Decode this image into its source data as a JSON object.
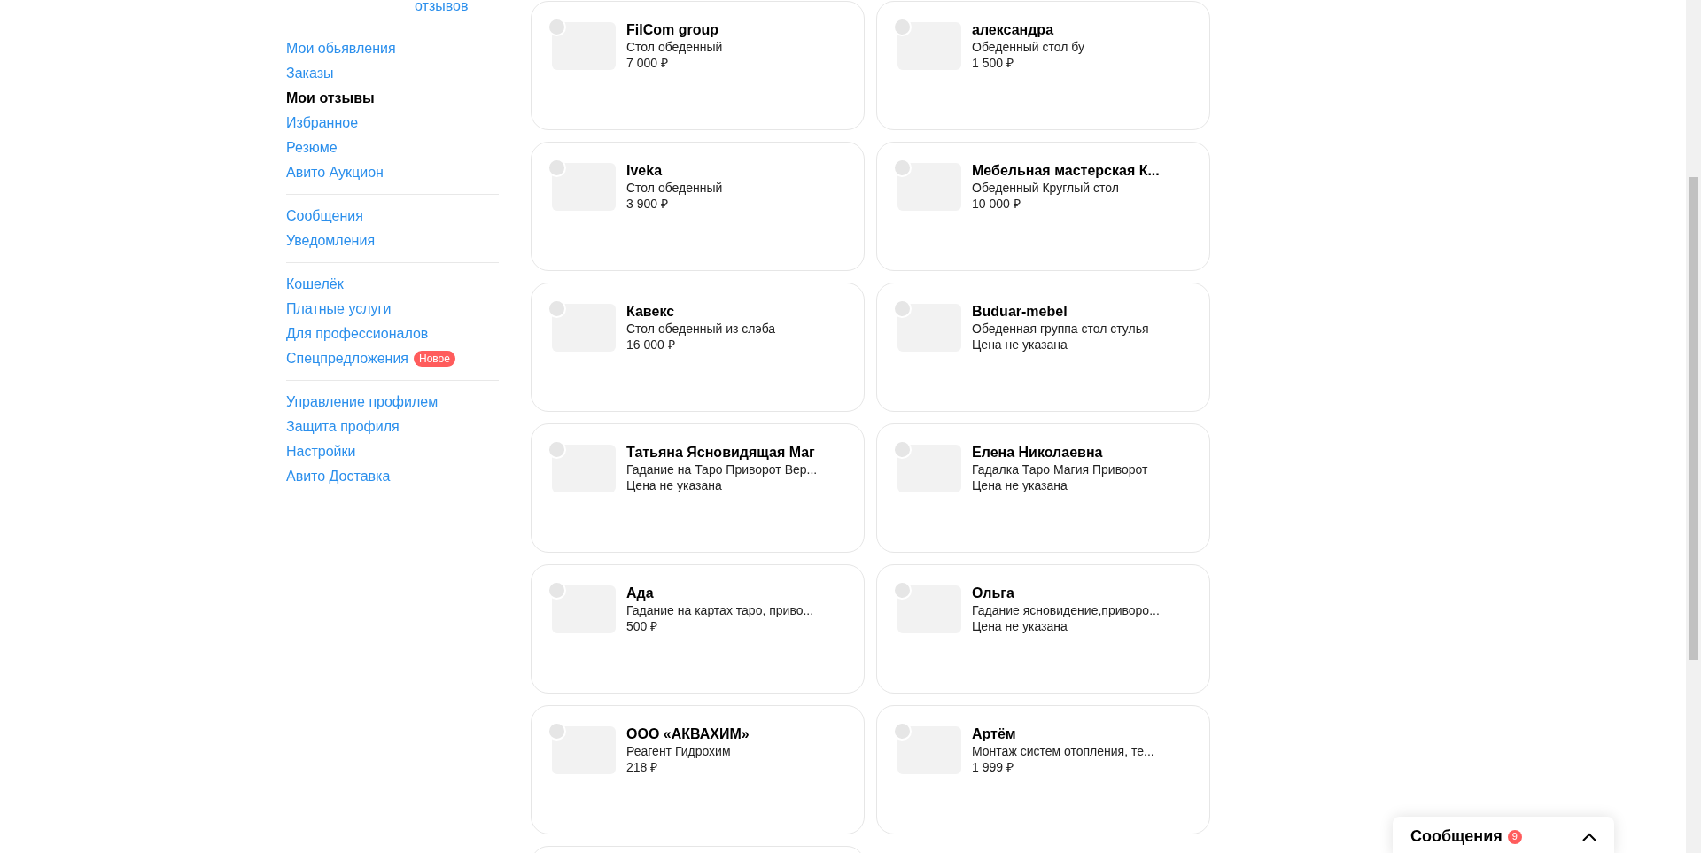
{
  "sidebar": {
    "top_link": "отзывов",
    "groups": [
      [
        {
          "label": "Мои обьявления",
          "selected": false
        },
        {
          "label": "Заказы",
          "selected": false
        },
        {
          "label": "Мои отзывы",
          "selected": true
        },
        {
          "label": "Избранное",
          "selected": false
        },
        {
          "label": "Резюме",
          "selected": false
        },
        {
          "label": "Авито Аукцион",
          "selected": false
        }
      ],
      [
        {
          "label": "Сообщения",
          "selected": false
        },
        {
          "label": "Уведомления",
          "selected": false
        }
      ],
      [
        {
          "label": "Кошелёк",
          "selected": false
        },
        {
          "label": "Платные услуги",
          "selected": false
        },
        {
          "label": "Для профессионалов",
          "selected": false
        },
        {
          "label": "Спецпредложения",
          "selected": false,
          "badge": "Новое"
        }
      ],
      [
        {
          "label": "Управление профилем",
          "selected": false
        },
        {
          "label": "Защита профиля",
          "selected": false
        },
        {
          "label": "Настройки",
          "selected": false
        },
        {
          "label": "Авито Доставка",
          "selected": false
        }
      ]
    ]
  },
  "review_cards": [
    {
      "name": "FilCom group",
      "description": "Стол обеденный",
      "price": "7 000 ₽"
    },
    {
      "name": "александра",
      "description": "Обеденный стол бу",
      "price": "1 500 ₽"
    },
    {
      "name": "Iveka",
      "description": "Стол обеденный",
      "price": "3 900 ₽"
    },
    {
      "name": "Мебельная мастерская К...",
      "description": "Обеденный Круглый стол",
      "price": "10 000 ₽"
    },
    {
      "name": "Кавекс",
      "description": "Стол обеденный из слэба",
      "price": "16 000 ₽"
    },
    {
      "name": "Buduar-mebel",
      "description": "Обеденная группа стол стулья",
      "price": "Цена не указана"
    },
    {
      "name": "Татьяна Ясновидящая Маг",
      "description": "Гадание на Таро Приворот Вер...",
      "price": "Цена не указана"
    },
    {
      "name": "Елена Николаевна",
      "description": "Гадалка Таро Магия Приворот",
      "price": "Цена не указана"
    },
    {
      "name": "Ада",
      "description": "Гадание на картах таро, приво...",
      "price": "500 ₽"
    },
    {
      "name": "Ольга",
      "description": "Гадание ясновидение,приворо...",
      "price": "Цена не указана"
    },
    {
      "name": "ООО «АКВАХИМ»",
      "description": "Реагент Гидрохим",
      "price": "218 ₽"
    },
    {
      "name": "Артём",
      "description": "Монтаж систем отопления, те...",
      "price": "1 999 ₽"
    }
  ],
  "messages_widget": {
    "label": "Сообщения",
    "count": "9",
    "expanded": false
  }
}
